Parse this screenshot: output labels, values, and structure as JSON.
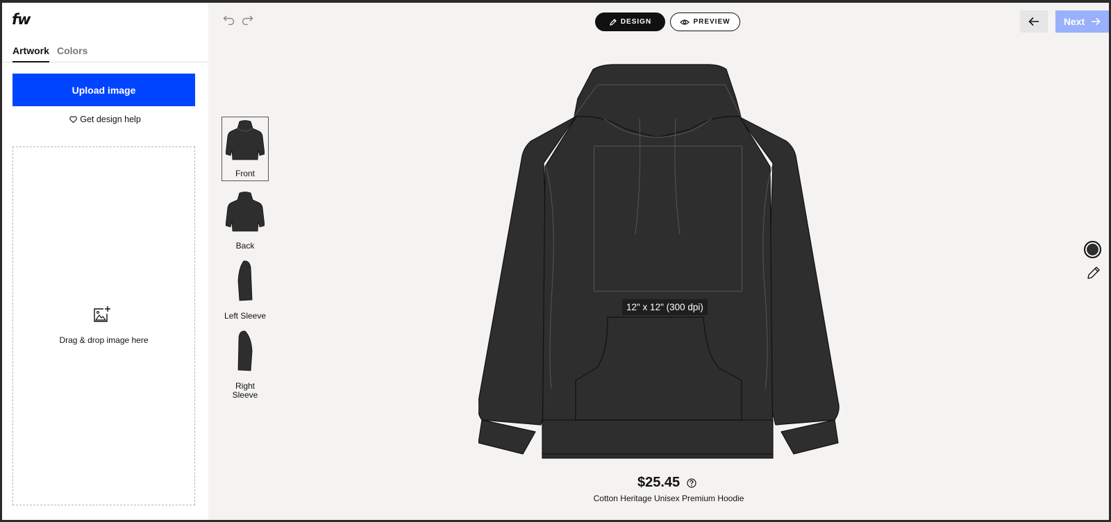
{
  "brand": {
    "logo_text": "fw"
  },
  "left_panel": {
    "tabs": [
      {
        "label": "Artwork",
        "active": true
      },
      {
        "label": "Colors",
        "active": false
      }
    ],
    "upload_button_label": "Upload image",
    "help_link_label": "Get design help",
    "dropzone_text": "Drag & drop image here"
  },
  "toolbar": {
    "undo_icon": "undo-icon",
    "redo_icon": "redo-icon",
    "design_label": "DESIGN",
    "preview_label": "PREVIEW",
    "next_label": "Next"
  },
  "views": [
    {
      "label": "Front",
      "selected": true
    },
    {
      "label": "Back",
      "selected": false
    },
    {
      "label": "Left Sleeve",
      "selected": false
    },
    {
      "label": "Right Sleeve",
      "selected": false
    }
  ],
  "canvas": {
    "print_area_label": "12\" x 12\" (300 dpi)",
    "garment_color": "#2e2e2e"
  },
  "product": {
    "price": "$25.45",
    "name": "Cotton Heritage Unisex Premium Hoodie"
  },
  "colors": {
    "accent": "#0044ff",
    "next_disabled": "#99b0fc",
    "background": "#f4f3f1"
  }
}
